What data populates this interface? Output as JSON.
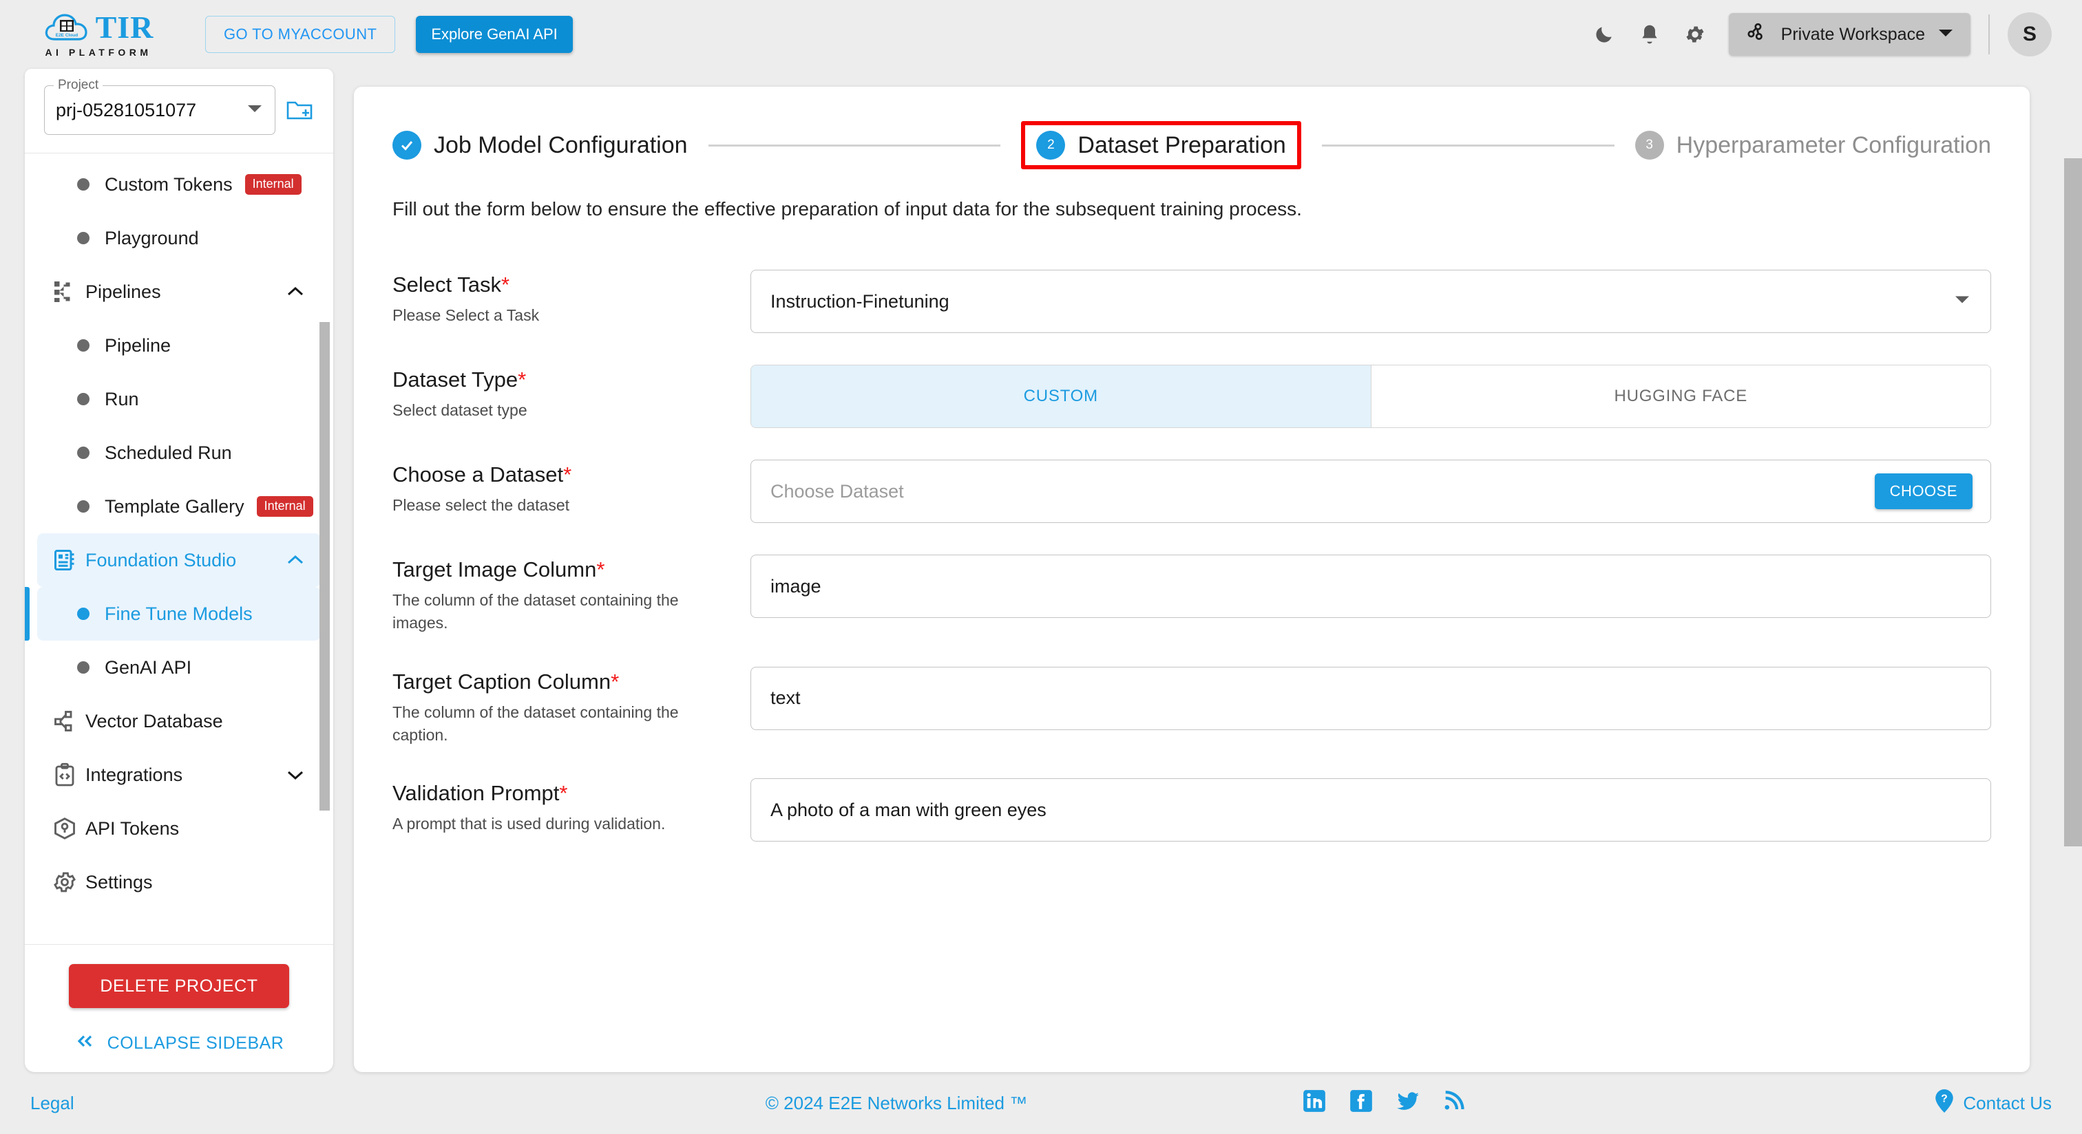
{
  "header": {
    "logo": {
      "brand": "TIR",
      "tagline": "AI PLATFORM",
      "cloud_text": "E2E Cloud",
      "icon": "cloud-grid-logo"
    },
    "myaccount_button": "GO TO MYACCOUNT",
    "genai_button": "Explore GenAI API",
    "icons": {
      "dark_mode": "moon-icon",
      "notifications": "bell-icon",
      "settings": "gear-icon",
      "workspace": "workspace-icon",
      "caret": "chevron-down-icon"
    },
    "workspace_label": "Private Workspace",
    "avatar_initial": "S"
  },
  "sidebar": {
    "project": {
      "label": "Project",
      "value": "prj-05281051077",
      "new_project_icon": "new-folder-icon",
      "caret_icon": "dropdown-caret-icon"
    },
    "items": [
      {
        "label": "Custom Tokens",
        "type": "leaf",
        "badge": "Internal",
        "icon": "dot-icon"
      },
      {
        "label": "Playground",
        "type": "leaf",
        "icon": "dot-icon"
      },
      {
        "label": "Pipelines",
        "type": "section",
        "expanded": true,
        "icon": "pipelines-icon",
        "chevron": "chevron-up-icon"
      },
      {
        "label": "Pipeline",
        "type": "leaf",
        "icon": "dot-icon"
      },
      {
        "label": "Run",
        "type": "leaf",
        "icon": "dot-icon"
      },
      {
        "label": "Scheduled Run",
        "type": "leaf",
        "icon": "dot-icon"
      },
      {
        "label": "Template Gallery",
        "type": "leaf",
        "badge": "Internal",
        "icon": "dot-icon"
      },
      {
        "label": "Foundation Studio",
        "type": "section",
        "active": true,
        "expanded": true,
        "icon": "foundation-studio-icon",
        "chevron": "chevron-up-icon"
      },
      {
        "label": "Fine Tune Models",
        "type": "leaf",
        "active": true,
        "icon": "dot-icon"
      },
      {
        "label": "GenAI API",
        "type": "leaf",
        "icon": "dot-icon"
      },
      {
        "label": "Vector Database",
        "type": "section",
        "icon": "vector-database-icon"
      },
      {
        "label": "Integrations",
        "type": "section",
        "expanded": false,
        "icon": "integrations-icon",
        "chevron": "chevron-down-icon"
      },
      {
        "label": "API Tokens",
        "type": "section",
        "icon": "api-tokens-icon"
      },
      {
        "label": "Settings",
        "type": "section",
        "icon": "settings-gear-icon"
      }
    ],
    "delete_button": "DELETE PROJECT",
    "collapse_label": "COLLAPSE SIDEBAR",
    "collapse_icon": "double-chevron-left-icon"
  },
  "main": {
    "steps": [
      {
        "num": "1",
        "label": "Job Model Configuration",
        "state": "done"
      },
      {
        "num": "2",
        "label": "Dataset Preparation",
        "state": "current",
        "highlighted": true
      },
      {
        "num": "3",
        "label": "Hyperparameter Configuration",
        "state": "todo"
      }
    ],
    "subtitle": "Fill out the form below to ensure the effective preparation of input data for the subsequent training process.",
    "fields": [
      {
        "title": "Select Task",
        "required": "*",
        "hint": "Please Select a Task",
        "control": "select",
        "value": "Instruction-Finetuning",
        "caret_icon": "dropdown-caret-icon"
      },
      {
        "title": "Dataset Type",
        "required": "*",
        "hint": "Select dataset type",
        "control": "segmented",
        "options": [
          {
            "label": "CUSTOM",
            "selected": true
          },
          {
            "label": "HUGGING FACE",
            "selected": false
          }
        ]
      },
      {
        "title": "Choose a Dataset",
        "required": "*",
        "hint": "Please select the dataset",
        "control": "text-with-button",
        "value": "",
        "placeholder": "Choose Dataset",
        "button": "CHOOSE"
      },
      {
        "title": "Target Image Column",
        "required": "*",
        "hint": "The column of the dataset containing the images.",
        "control": "text",
        "value": "image"
      },
      {
        "title": "Target Caption Column",
        "required": "*",
        "hint": "The column of the dataset containing the caption.",
        "control": "text",
        "value": "text"
      },
      {
        "title": "Validation Prompt",
        "required": "*",
        "hint": "A prompt that is used during validation.",
        "control": "text",
        "value": "A photo of a man with green eyes"
      }
    ]
  },
  "footer": {
    "legal": "Legal",
    "copyright": "© 2024 E2E Networks Limited ™",
    "social": [
      "linkedin-icon",
      "facebook-icon",
      "twitter-icon",
      "rss-icon"
    ],
    "contact": "Contact Us",
    "contact_icon": "help-marker-icon"
  },
  "colors": {
    "accent": "#1b9be0",
    "danger": "#d32f2f",
    "highlight": "#f60000",
    "selected_bg": "#eaf4fd"
  }
}
